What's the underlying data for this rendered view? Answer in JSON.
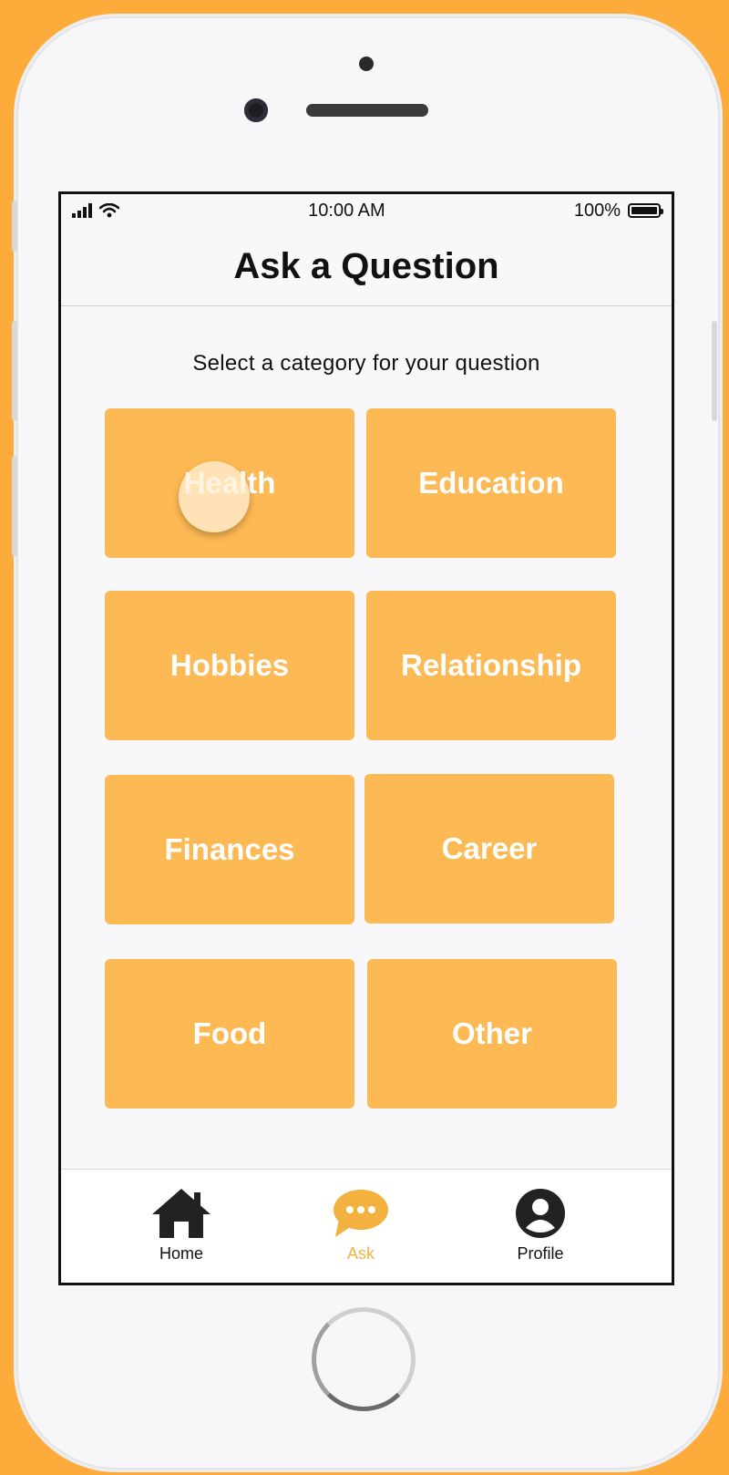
{
  "status_bar": {
    "time": "10:00 AM",
    "battery": "100%"
  },
  "header": {
    "title": "Ask a Question"
  },
  "main": {
    "subtitle": "Select a category for your question",
    "categories": [
      "Health",
      "Education",
      "Hobbies",
      "Relationship",
      "Finances",
      "Career",
      "Food",
      "Other"
    ]
  },
  "tab_bar": {
    "items": [
      {
        "label": "Home",
        "icon": "home-icon",
        "active": false
      },
      {
        "label": "Ask",
        "icon": "chat-bubble-icon",
        "active": true
      },
      {
        "label": "Profile",
        "icon": "user-icon",
        "active": false
      }
    ]
  },
  "colors": {
    "background": "#FDAB3B",
    "tile": "#FDB953",
    "tile_text": "#FFFFFF",
    "active_tab": "#F3B23F",
    "icon": "#222222"
  }
}
